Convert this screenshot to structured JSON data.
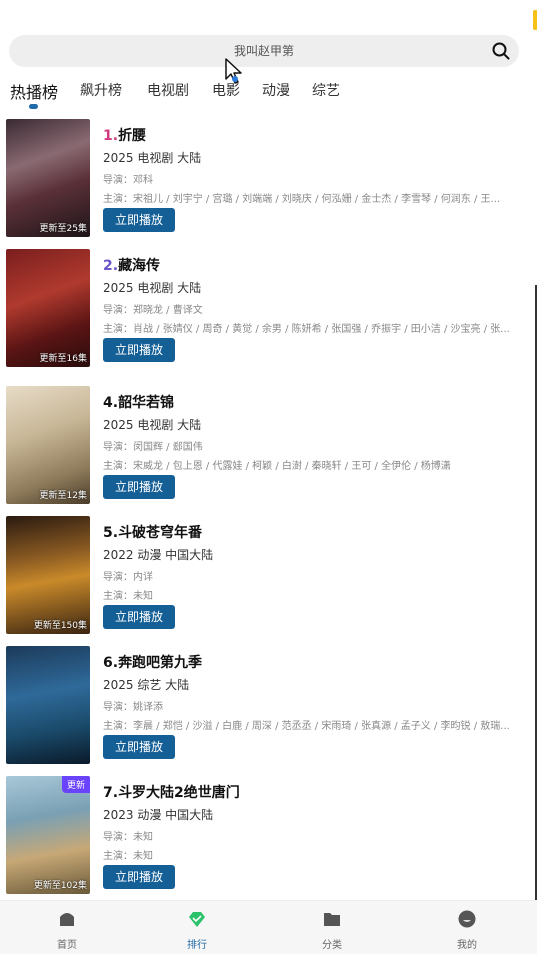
{
  "search": {
    "placeholder": "我叫赵甲第"
  },
  "tabs": [
    {
      "label": "热播榜",
      "active": true
    },
    {
      "label": "飙升榜"
    },
    {
      "label": "电视剧"
    },
    {
      "label": "电影"
    },
    {
      "label": "动漫"
    },
    {
      "label": "综艺"
    }
  ],
  "items": [
    {
      "rank": "1.",
      "name": "折腰",
      "meta": "2025  电视剧  大陆",
      "director": "导演：邓科",
      "cast": "主演：宋祖儿 / 刘宇宁 / 宫璐 / 刘端端 / 刘晓庆 / 何泓姗 / 金士杰 / 李雪琴 / 何润东 / 王...",
      "update": "更新至25集",
      "play": "立即播放"
    },
    {
      "rank": "2.",
      "name": "藏海传",
      "meta": "2025  电视剧  大陆",
      "director": "导演：郑晓龙 / 曹译文",
      "cast": "主演：肖战 / 张婧仪 / 周奇 / 黄觉 / 余男 / 陈妍希 / 张国强 / 乔振宇 / 田小洁 / 沙宝亮 / 张...",
      "update": "更新至16集",
      "play": "立即播放"
    },
    {
      "rank": "4.",
      "name": "韶华若锦",
      "meta": "2025  电视剧  大陆",
      "director": "导演：闵国辉 / 郄国伟",
      "cast": "主演：宋威龙 / 包上恩 / 代露娃 / 柯颖 / 白澍 / 秦晓轩 / 王可 / 全伊伦 / 杨博潇",
      "update": "更新至12集",
      "play": "立即播放"
    },
    {
      "rank": "5.",
      "name": "斗破苍穹年番",
      "meta": "2022  动漫  中国大陆",
      "director": "导演：内详",
      "cast": "主演：未知",
      "update": "更新至150集",
      "play": "立即播放"
    },
    {
      "rank": "6.",
      "name": "奔跑吧第九季",
      "meta": "2025  综艺  大陆",
      "director": "导演：姚译添",
      "cast": "主演：李晨 / 郑恺 / 沙溢 / 白鹿 / 周深 / 范丞丞 / 宋雨琦 / 张真源 / 孟子义 / 李昀锐 / 敖瑞...",
      "update": "",
      "play": "立即播放"
    },
    {
      "rank": "7.",
      "name": "斗罗大陆2绝世唐门",
      "meta": "2023  动漫  中国大陆",
      "director": "导演：未知",
      "cast": "主演：未知",
      "update": "更新至102集",
      "corner": "更新",
      "play": "立即播放"
    }
  ],
  "bottom_nav": [
    {
      "label": "首页"
    },
    {
      "label": "排行",
      "active": true
    },
    {
      "label": "分类"
    },
    {
      "label": "我的"
    }
  ],
  "colors": {
    "accent": "#155f97",
    "rank1": "#d33a7e",
    "rank2": "#6b55c8",
    "nav_active": "#1f6aa8"
  }
}
